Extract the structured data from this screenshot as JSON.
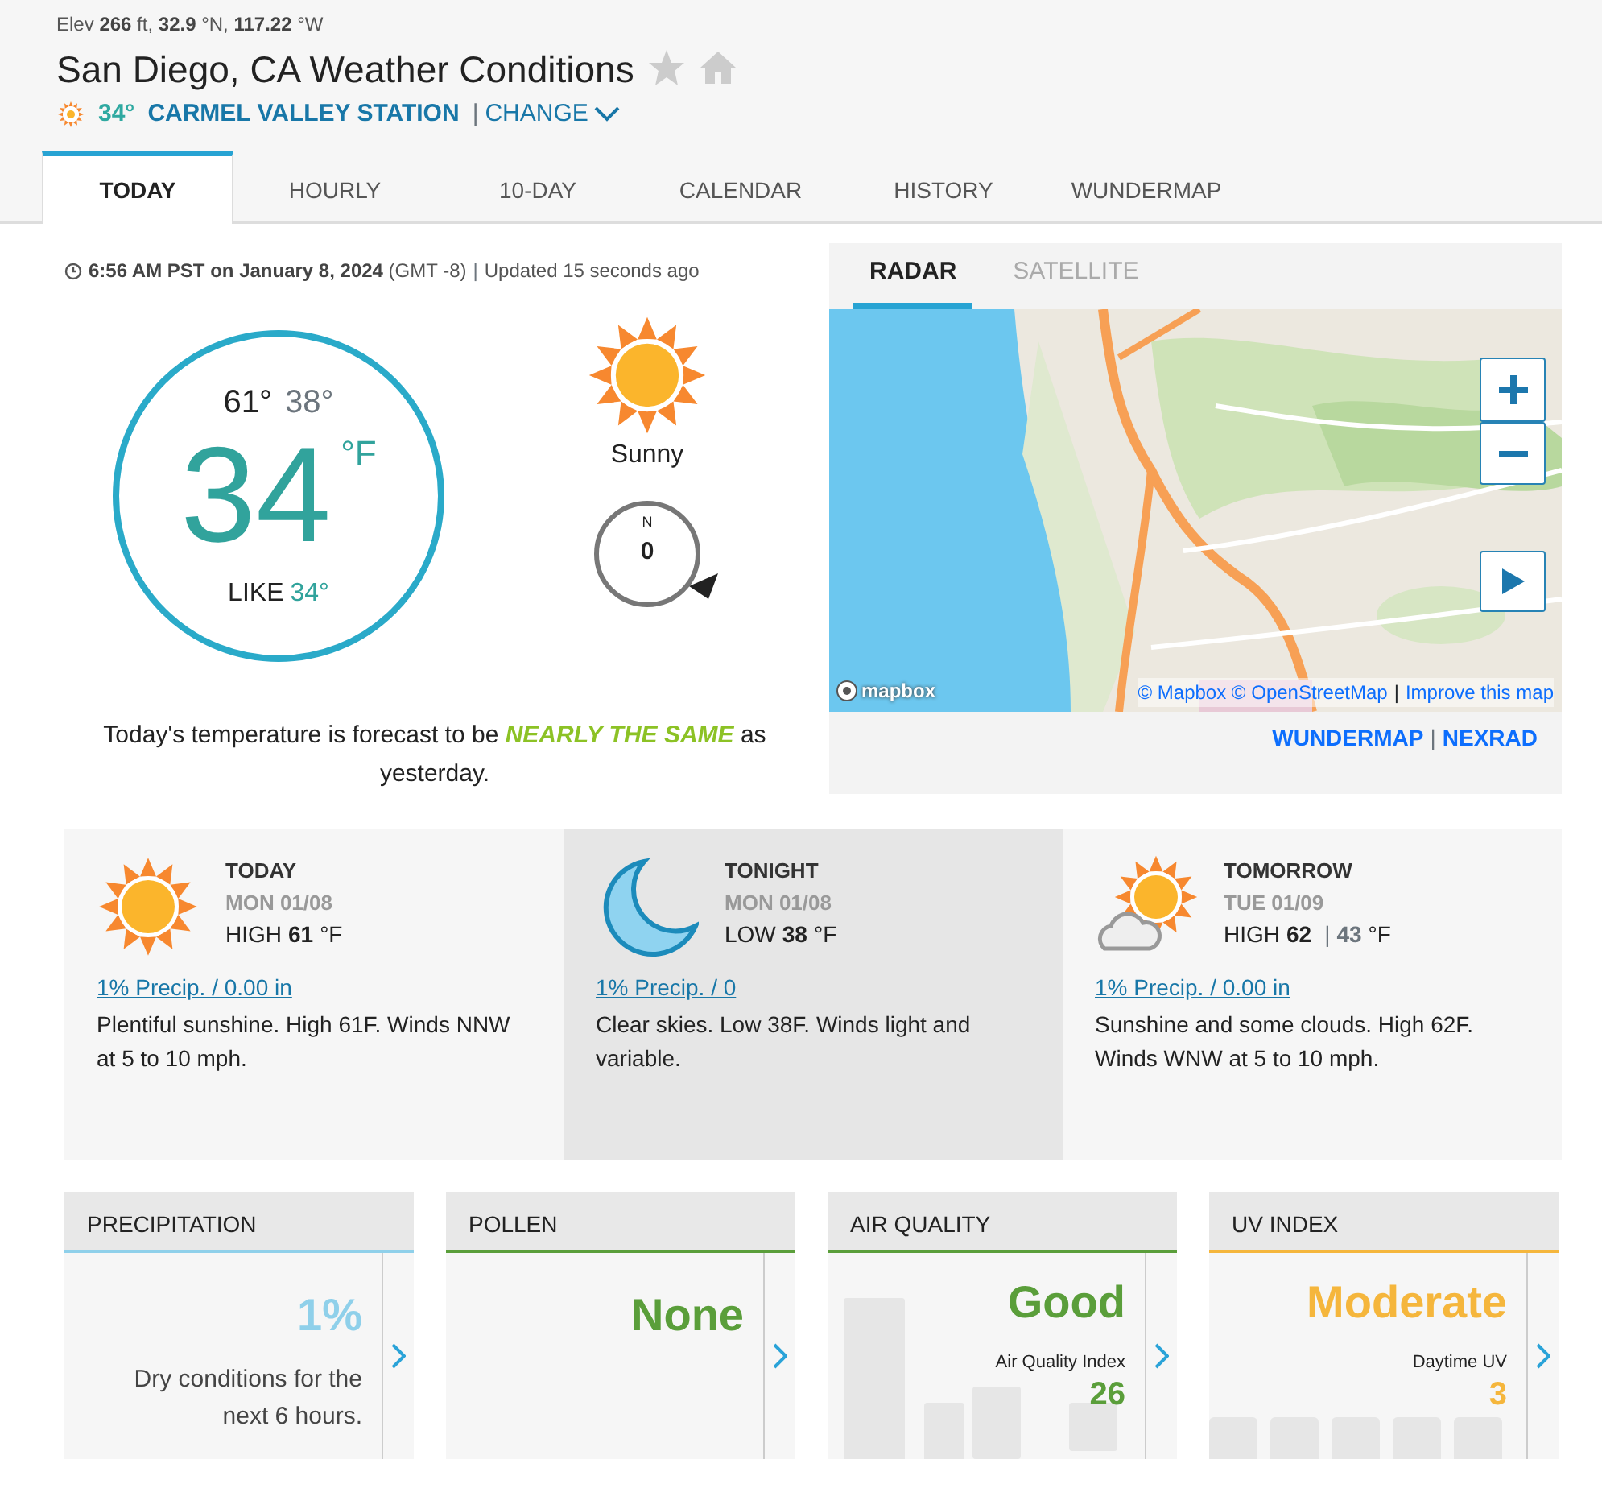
{
  "header": {
    "elevation": "Elev **266** ft, **32.9** °N, **117.22** °W",
    "title": "San Diego, CA Weather Conditions",
    "station_temp": "34°",
    "station": "CARMEL VALLEY STATION",
    "separator": "|",
    "change": "CHANGE"
  },
  "tabs": [
    {
      "label": "TODAY",
      "selected": true
    },
    {
      "label": "HOURLY",
      "selected": false
    },
    {
      "label": "10-DAY",
      "selected": false
    },
    {
      "label": "CALENDAR",
      "selected": false
    },
    {
      "label": "HISTORY",
      "selected": false
    },
    {
      "label": "WUNDERMAP",
      "selected": false
    }
  ],
  "observation": {
    "time": "**6:56 AM PST on January 8, 2024** (GMT -8)",
    "separator": "|",
    "updated": "Updated 15 seconds ago",
    "high": "61°",
    "low": "38°",
    "temp": "34",
    "unit": "°F",
    "feels_label": "LIKE",
    "feels": "34°",
    "condition": "Sunny",
    "wind_dir": "N",
    "wind_speed": "0",
    "summary": "Today's temperature is forecast to be **NEARLY THE SAME** as yesterday."
  },
  "map": {
    "tabs": [
      {
        "label": "RADAR",
        "selected": true
      },
      {
        "label": "SATELLITE",
        "selected": false
      }
    ],
    "logo": "mapbox",
    "attribution": "© Mapbox © OpenStreetMap",
    "attribution_separator": "|",
    "improve": "Improve this map",
    "links": [
      "WUNDERMAP",
      "NEXRAD"
    ],
    "link_separator": "|"
  },
  "forecast": [
    {
      "kind": "sun",
      "selected": false,
      "title": "TODAY",
      "date": "MON 01/08",
      "temp_label": "HIGH",
      "temp": "61",
      "unit": "°F",
      "precip": "1% Precip. / 0.00 in",
      "description": "Plentiful sunshine. High 61F. Winds NNW at 5 to 10 mph."
    },
    {
      "kind": "moon",
      "selected": true,
      "title": "TONIGHT",
      "date": "MON 01/08",
      "temp_label": "LOW",
      "temp": "38",
      "unit": "°F",
      "precip": "1% Precip. / 0",
      "description": "Clear skies. Low 38F. Winds light and variable."
    },
    {
      "kind": "partly",
      "selected": false,
      "title": "TOMORROW",
      "date": "TUE 01/09",
      "temp_label": "HIGH",
      "temp": "62",
      "separator": "|",
      "secondary": "43",
      "unit": "°F",
      "precip": "1% Precip. / 0.00 in",
      "description": "Sunshine and some clouds. High 62F. Winds WNW at 5 to 10 mph."
    }
  ],
  "cards": [
    {
      "kind": "text",
      "title": "PRECIPITATION",
      "color": "#8fd0ea",
      "value": "1%",
      "description": "Dry conditions for the next 6 hours."
    },
    {
      "kind": "plain",
      "title": "POLLEN",
      "color": "#5a9e3a",
      "value": "None"
    },
    {
      "kind": "index",
      "title": "AIR QUALITY",
      "color": "#5a9e3a",
      "value": "Good",
      "label": "Air Quality Index",
      "number": "26"
    },
    {
      "kind": "index",
      "title": "UV INDEX",
      "color": "#f5b63c",
      "value": "Moderate",
      "label": "Daytime UV",
      "number": "3"
    }
  ]
}
